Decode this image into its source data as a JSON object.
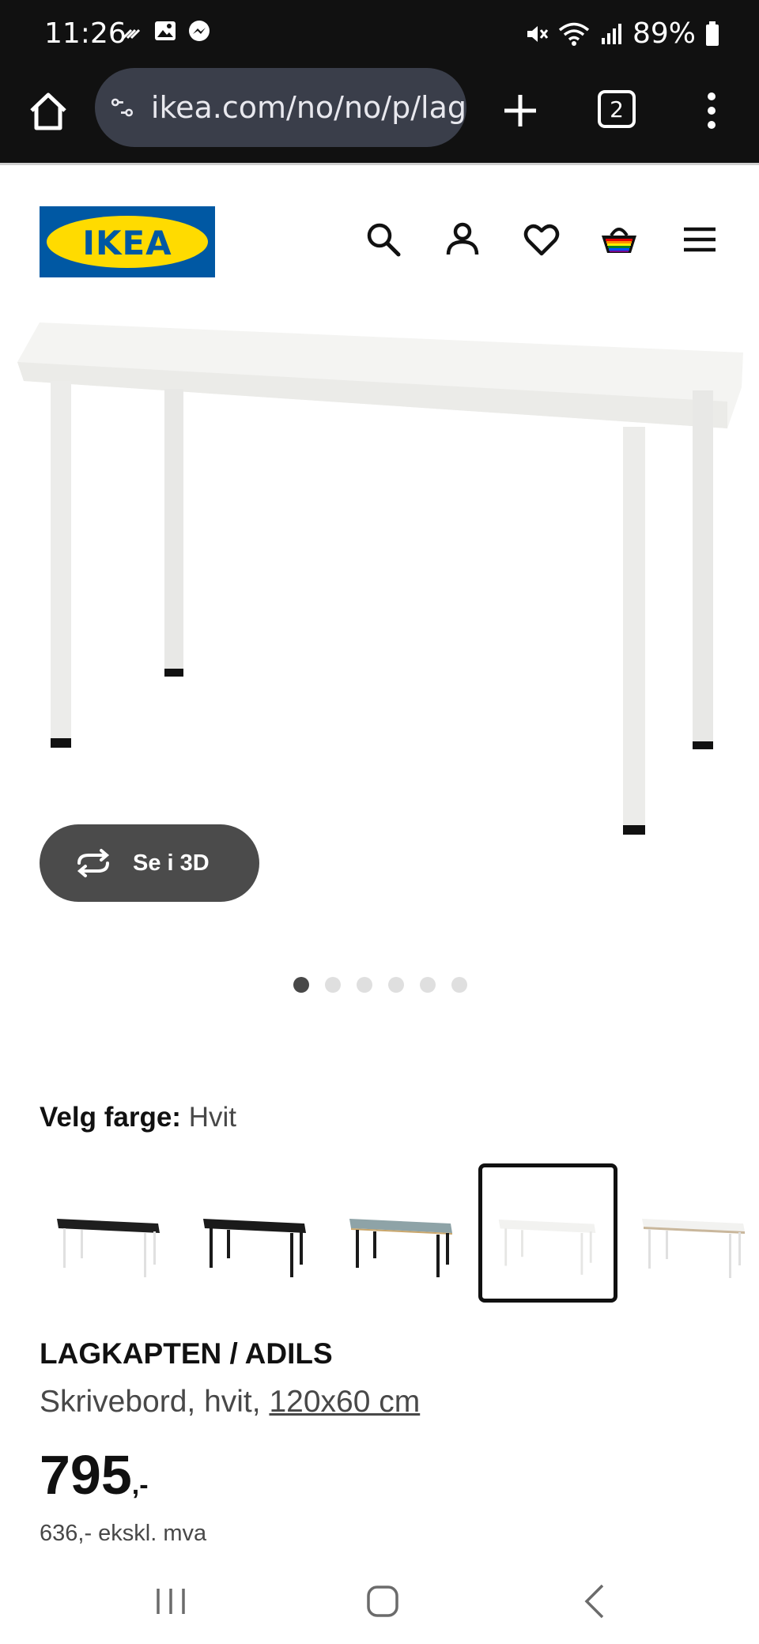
{
  "status_bar": {
    "time": "11:26",
    "battery": "89%",
    "left_icons": [
      "missed-call-icon",
      "gallery-icon",
      "messenger-icon"
    ],
    "right_icons": [
      "mute-icon",
      "wifi-icon",
      "signal-icon",
      "battery-icon"
    ]
  },
  "browser": {
    "url": "ikea.com/no/no/p/lag",
    "tab_count": "2"
  },
  "header": {
    "logo_text": "IKEA",
    "icons": [
      "search-icon",
      "account-icon",
      "favorites-icon",
      "cart-icon",
      "menu-icon"
    ]
  },
  "gallery": {
    "view_3d_label": "Se i 3D",
    "image_count": 6,
    "active_index": 0
  },
  "color_picker": {
    "label": "Velg farge:",
    "selected_value": "Hvit",
    "selected_index": 3,
    "options": [
      "black-white-legs",
      "black-black-legs",
      "grey-blue-black-legs",
      "white",
      "white-anthracite-edge"
    ]
  },
  "product": {
    "name": "LAGKAPTEN / ADILS",
    "description_prefix": "Skrivebord, hvit,",
    "size": "120x60 cm",
    "price": "795",
    "price_suffix": ",-",
    "price_excl_vat": "636,- ekskl. mva"
  },
  "nav_bar": {
    "icons": [
      "recents-icon",
      "home-icon",
      "back-icon"
    ]
  },
  "colors": {
    "status_bg": "#111111",
    "url_pill": "#3a3e4a",
    "ikea_blue": "#0058a3",
    "ikea_yellow": "#ffdb00",
    "button_3d": "#4b4b4b"
  }
}
